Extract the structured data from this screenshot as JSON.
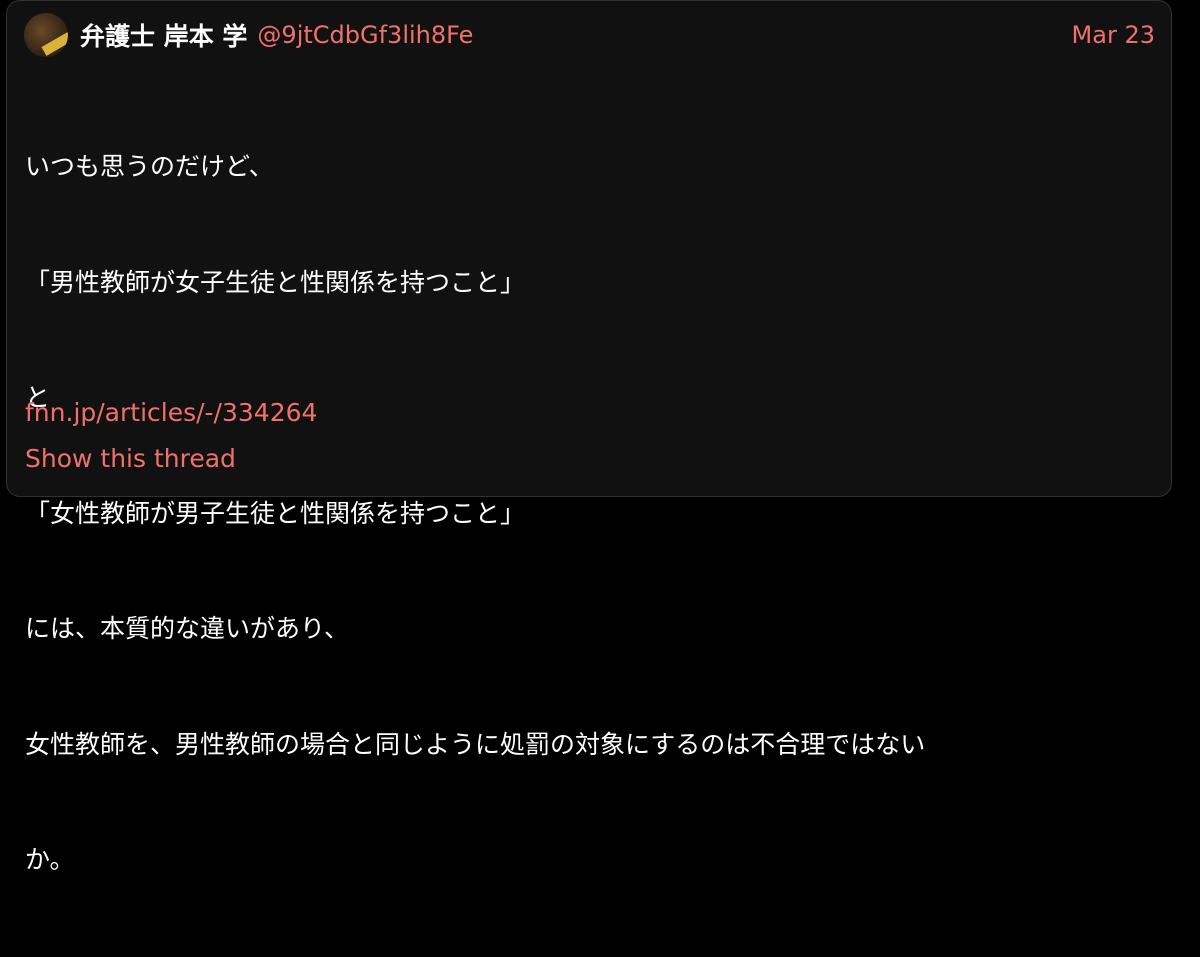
{
  "tweet": {
    "display_name": "弁護士 岸本 学",
    "handle": "@9jtCdbGf3lih8Fe",
    "date": "Mar 23",
    "lines": [
      "いつも思うのだけど、",
      "「男性教師が女子生徒と性関係を持つこと」",
      "と",
      "「女性教師が男子生徒と性関係を持つこと」",
      "には、本質的な違いがあり、",
      "女性教師を、男性教師の場合と同じように処罰の対象にするのは不合理ではない",
      "か。"
    ],
    "link": "fnn.jp/articles/-/334264",
    "show_thread": "Show this thread"
  },
  "colors": {
    "accent": "#f0706a",
    "background": "#111111",
    "text": "#ffffff"
  },
  "icons": {
    "avatar": "avatar-image"
  }
}
